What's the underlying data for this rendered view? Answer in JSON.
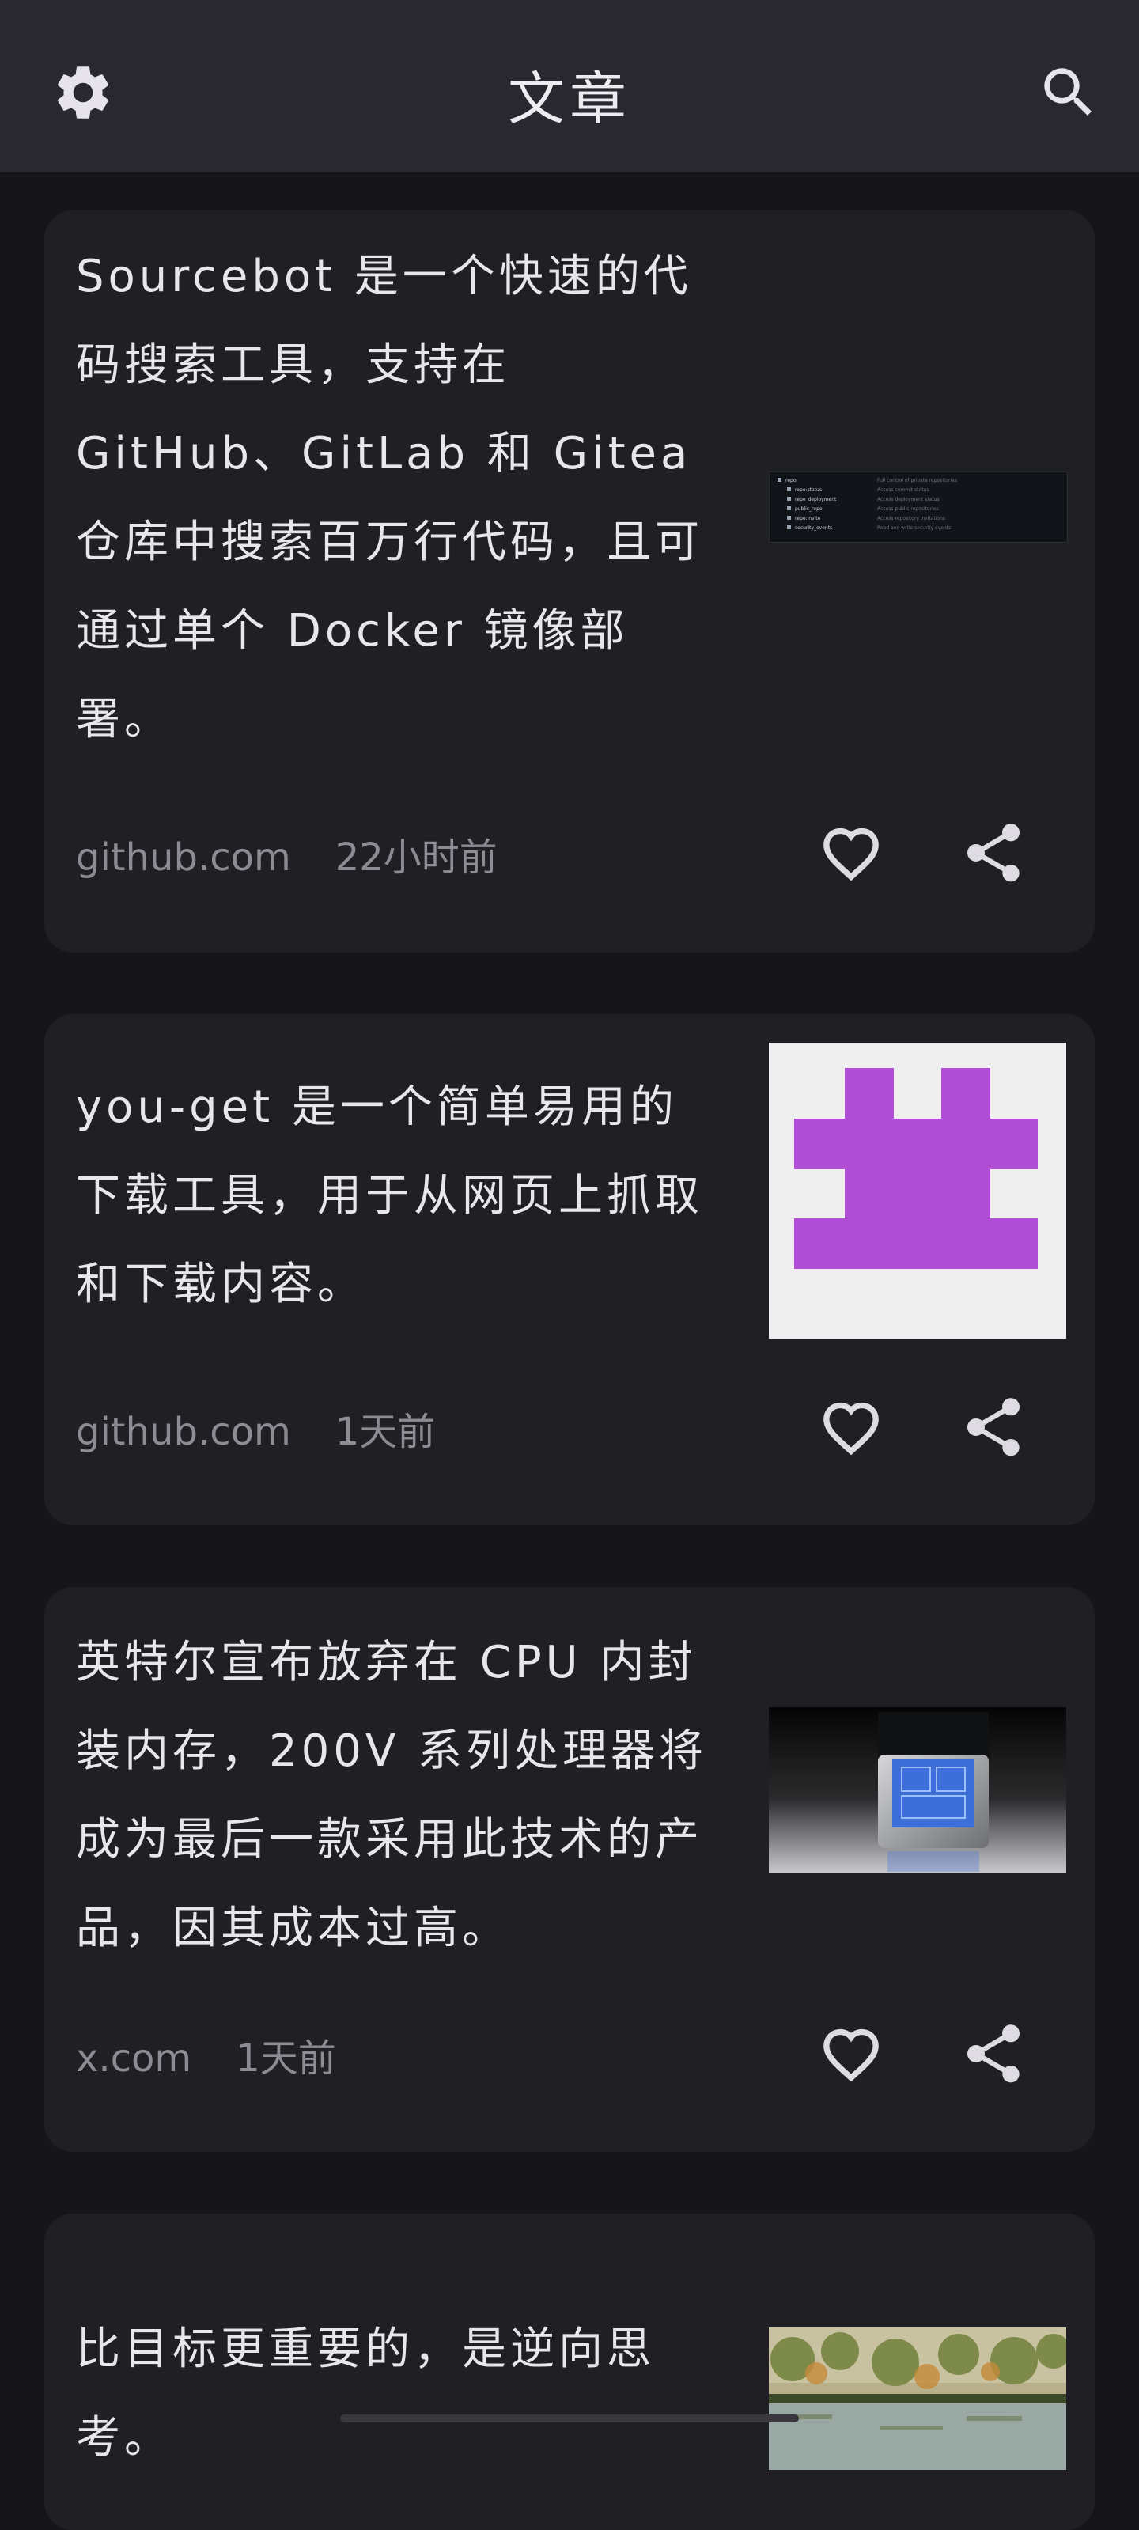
{
  "header": {
    "title": "文章",
    "left_icon": "gear-icon",
    "right_icon": "search-icon"
  },
  "articles": [
    {
      "text": "Sourcebot 是一个快速的代码搜索工具，支持在 GitHub、GitLab 和 Gitea 仓库中搜索百万行代码，且可通过单个 Docker 镜像部署。",
      "source": "github.com",
      "time": "22小时前",
      "thumb": {
        "rows": [
          [
            "repo",
            "Full control of private repositories"
          ],
          [
            "repo:status",
            "Access commit status"
          ],
          [
            "repo_deployment",
            "Access deployment status"
          ],
          [
            "public_repo",
            "Access public repositories"
          ],
          [
            "repo:invite",
            "Access repository invitations"
          ],
          [
            "security_events",
            "Read and write security events"
          ]
        ]
      }
    },
    {
      "text": "you-get 是一个简单易用的下载工具，用于从网页上抓取和下载内容。",
      "source": "github.com",
      "time": "1天前",
      "thumb": "purple-identicon"
    },
    {
      "text": "英特尔宣布放弃在 CPU 内封装内存，200V 系列处理器将成为最后一款采用此技术的产品，因其成本过高。",
      "source": "x.com",
      "time": "1天前",
      "thumb": "cpu-chip-render"
    },
    {
      "text": "比目标更重要的，是逆向思考。",
      "thumb": "impressionist-painting"
    }
  ],
  "actions": {
    "like_icon": "heart-icon",
    "share_icon": "share-icon"
  },
  "colors": {
    "background": "#161519",
    "header": "#29272f",
    "card": "#201f24",
    "identicon": "#b04fd6"
  }
}
